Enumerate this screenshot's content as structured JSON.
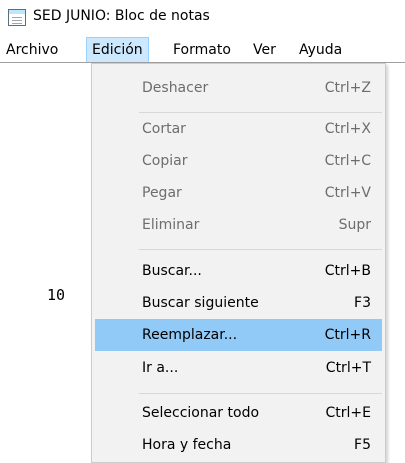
{
  "window": {
    "title": "SED JUNIO: Bloc de notas"
  },
  "menubar": [
    "Archivo",
    "Edición",
    "Formato",
    "Ver",
    "Ayuda"
  ],
  "editor": {
    "visible_text": "10"
  },
  "menu": {
    "items": [
      {
        "label": "Deshacer",
        "shortcut": "Ctrl+Z",
        "enabled": false
      },
      {
        "label": "Cortar",
        "shortcut": "Ctrl+X",
        "enabled": false
      },
      {
        "label": "Copiar",
        "shortcut": "Ctrl+C",
        "enabled": false
      },
      {
        "label": "Pegar",
        "shortcut": "Ctrl+V",
        "enabled": false
      },
      {
        "label": "Eliminar",
        "shortcut": "Supr",
        "enabled": false
      },
      {
        "label": "Buscar...",
        "shortcut": "Ctrl+B",
        "enabled": true
      },
      {
        "label": "Buscar siguiente",
        "shortcut": "F3",
        "enabled": true
      },
      {
        "label": "Reemplazar...",
        "shortcut": "Ctrl+R",
        "enabled": true,
        "highlighted": true
      },
      {
        "label": "Ir a...",
        "shortcut": "Ctrl+T",
        "enabled": true
      },
      {
        "label": "Seleccionar todo",
        "shortcut": "Ctrl+E",
        "enabled": true
      },
      {
        "label": "Hora y fecha",
        "shortcut": "F5",
        "enabled": true
      }
    ]
  },
  "colors": {
    "highlight": "#91c9f7",
    "menu_background": "#f2f2f2",
    "active_menu": "#cce8ff"
  }
}
